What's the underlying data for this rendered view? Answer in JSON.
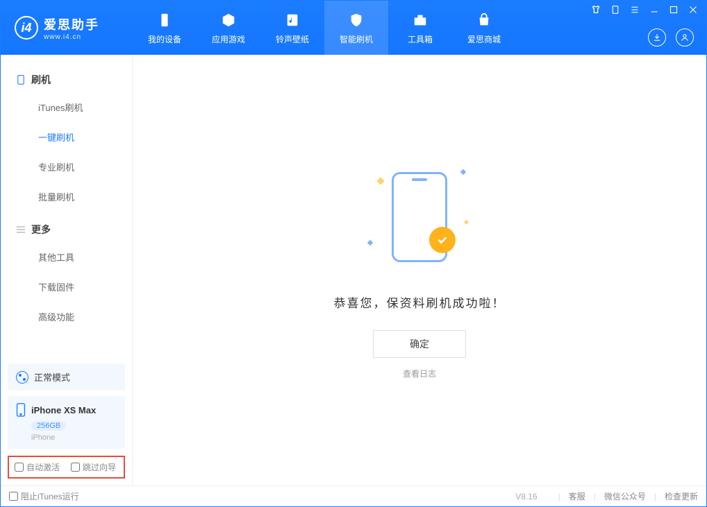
{
  "logo": {
    "cn": "爱思助手",
    "en": "www.i4.cn"
  },
  "nav": [
    {
      "label": "我的设备"
    },
    {
      "label": "应用游戏"
    },
    {
      "label": "铃声壁纸"
    },
    {
      "label": "智能刷机"
    },
    {
      "label": "工具箱"
    },
    {
      "label": "爱思商城"
    }
  ],
  "sidebar": {
    "group1_title": "刷机",
    "group1_items": [
      {
        "label": "iTunes刷机"
      },
      {
        "label": "一键刷机"
      },
      {
        "label": "专业刷机"
      },
      {
        "label": "批量刷机"
      }
    ],
    "group2_title": "更多",
    "group2_items": [
      {
        "label": "其他工具"
      },
      {
        "label": "下载固件"
      },
      {
        "label": "高级功能"
      }
    ]
  },
  "mode": {
    "label": "正常模式"
  },
  "device": {
    "name": "iPhone XS Max",
    "capacity": "256GB",
    "type": "iPhone"
  },
  "options": {
    "auto_activate": "自动激活",
    "skip_guide": "跳过向导"
  },
  "main": {
    "success_text": "恭喜您，保资料刷机成功啦！",
    "ok_button": "确定",
    "view_log": "查看日志"
  },
  "footer": {
    "block_itunes": "阻止iTunes运行",
    "version": "V8.16",
    "support": "客服",
    "wechat": "微信公众号",
    "check_update": "检查更新"
  }
}
